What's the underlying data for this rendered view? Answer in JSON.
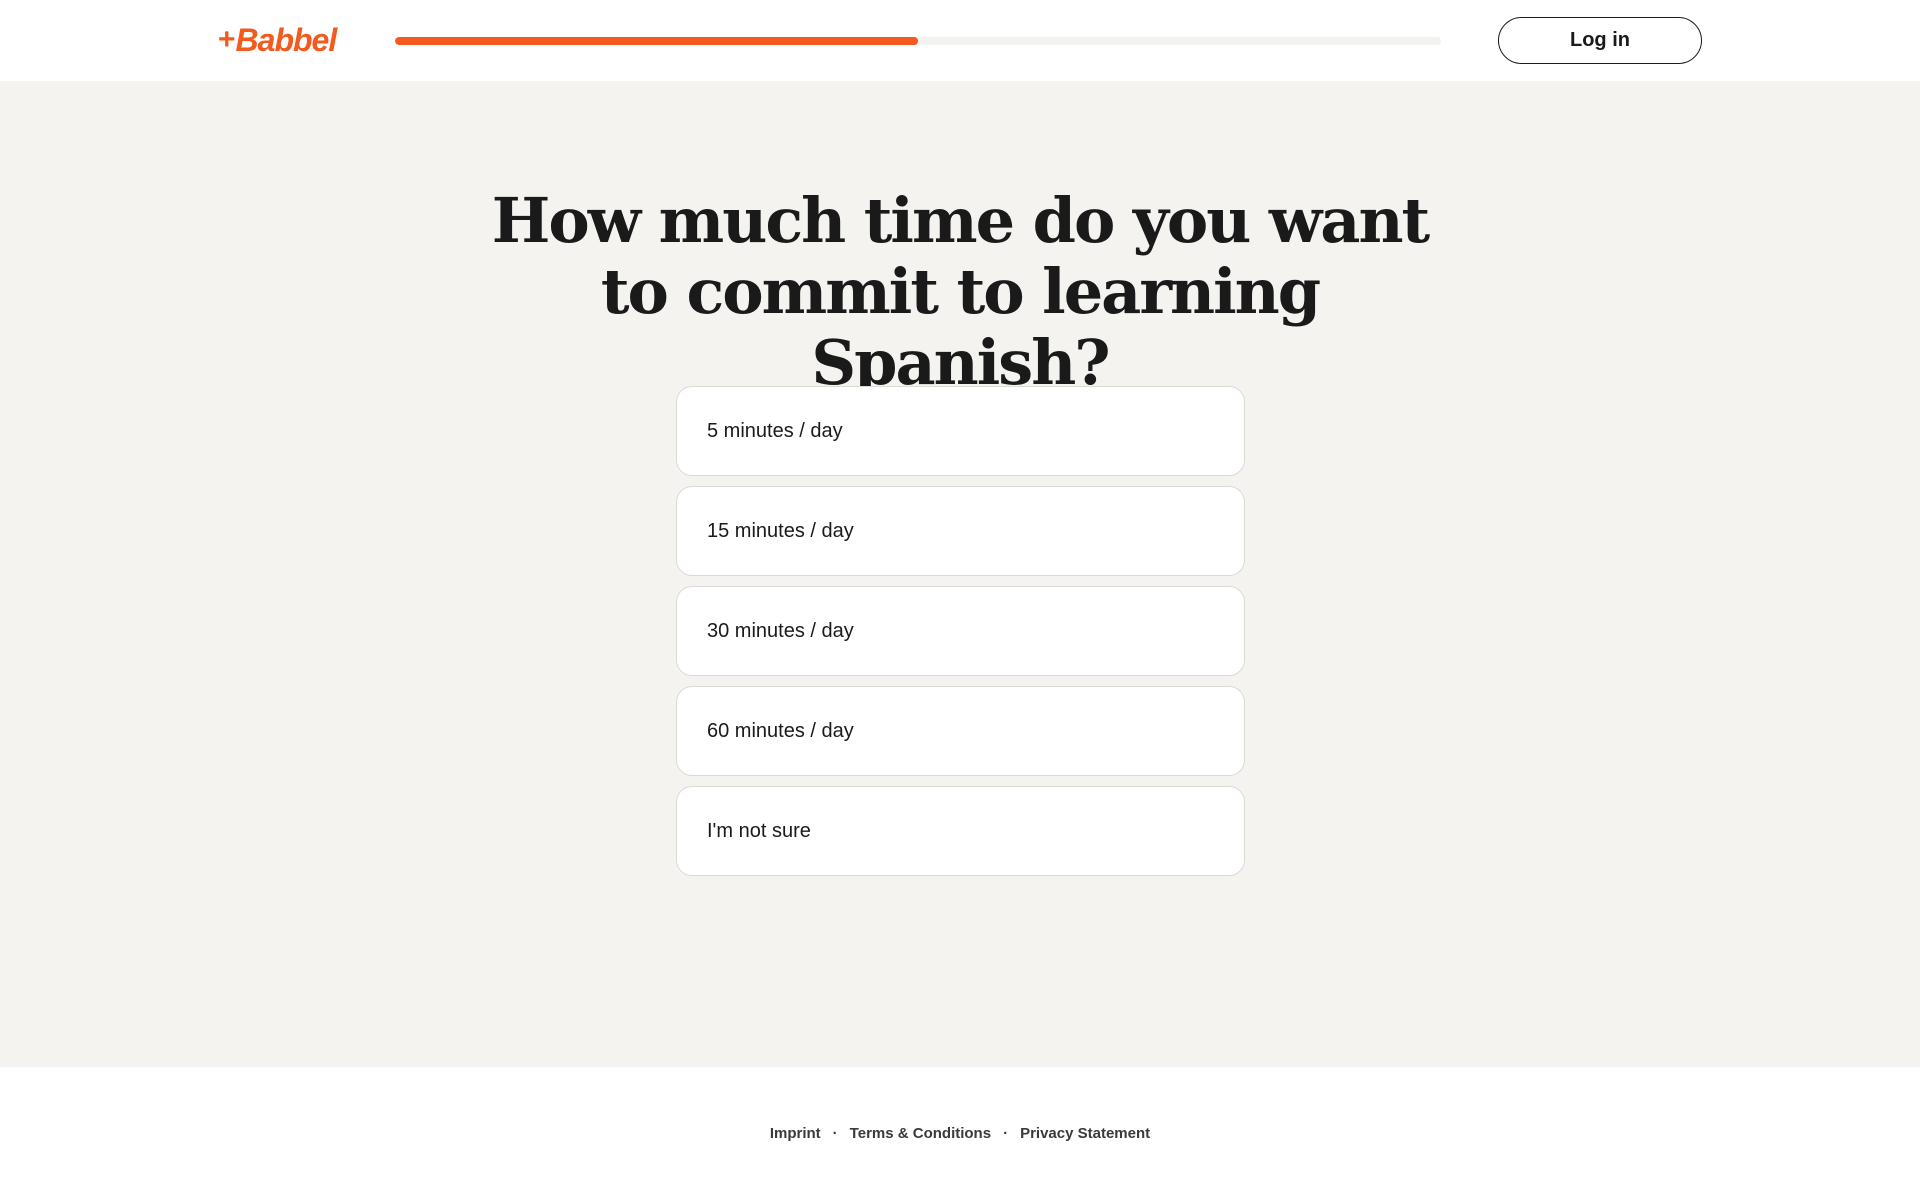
{
  "brand": {
    "logo_plus": "+",
    "logo_text": "Babbel",
    "accent_color": "#f25a1e"
  },
  "header": {
    "progress": 0.5,
    "login_label": "Log in"
  },
  "main": {
    "question": "How much time do you want to commit to learning Spanish?",
    "options": [
      {
        "label": "5 minutes / day"
      },
      {
        "label": "15 minutes / day"
      },
      {
        "label": "30 minutes / day"
      },
      {
        "label": "60 minutes / day"
      },
      {
        "label": "I'm not sure"
      }
    ]
  },
  "footer": {
    "links": [
      {
        "label": "Imprint"
      },
      {
        "label": "Terms & Conditions"
      },
      {
        "label": "Privacy Statement"
      }
    ],
    "separator": "·"
  }
}
